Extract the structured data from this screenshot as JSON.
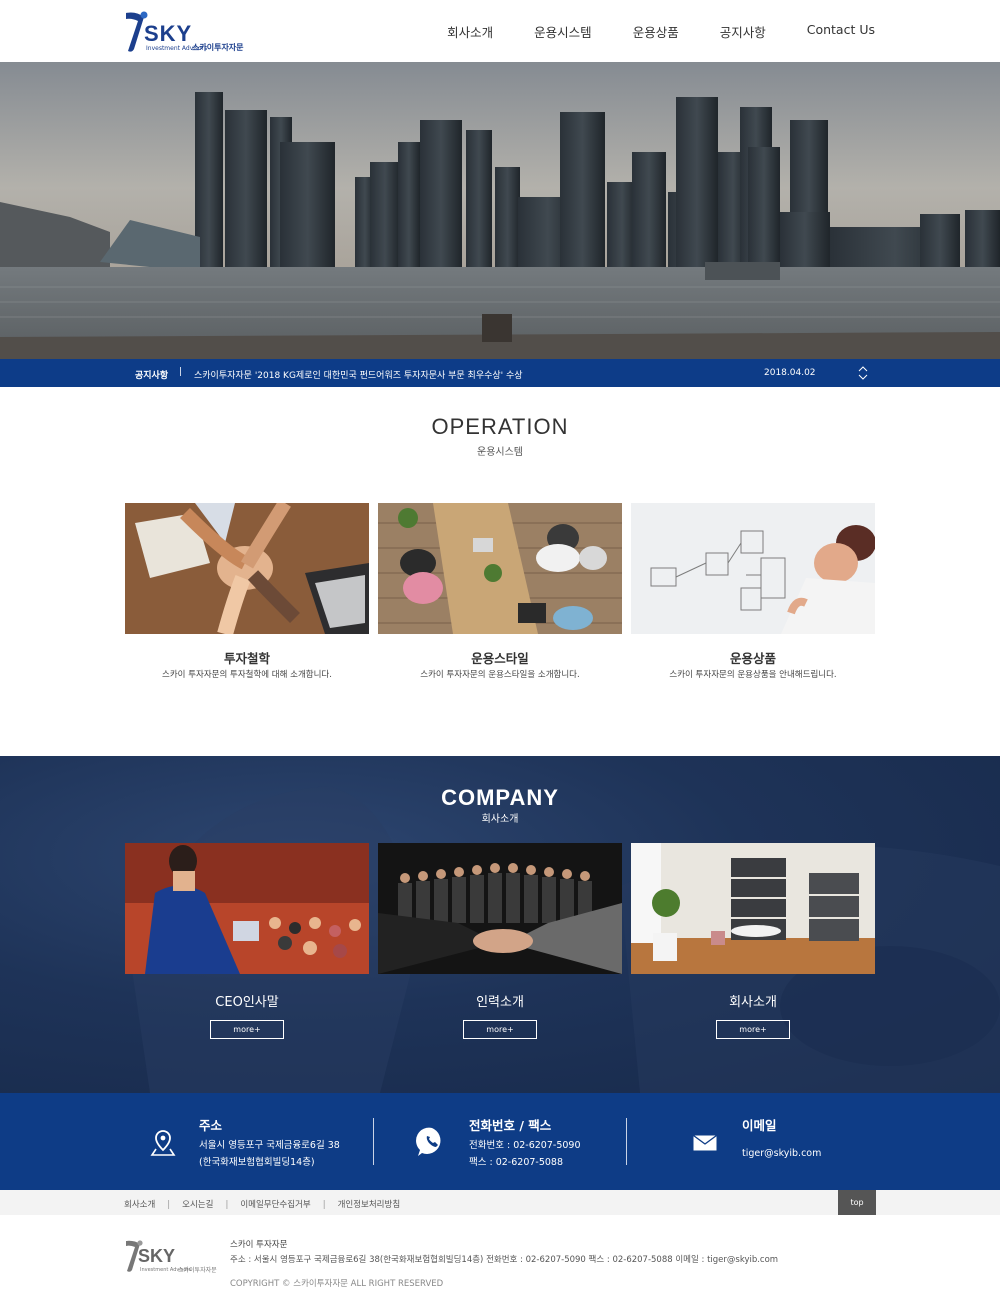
{
  "header": {
    "logo_text": "SKY",
    "logo_sub": "Investment Advisors",
    "logo_kr": "스카이투자자문",
    "nav": [
      "회사소개",
      "운용시스템",
      "운용상품",
      "공지사항",
      "Contact Us"
    ]
  },
  "notice": {
    "label": "공지사항",
    "separator": "|",
    "text": "스카이투자자문 '2018 KG제로인 대한민국 펀드어워즈 투자자문사 부문 최우수상' 수상",
    "date": "2018.04.02"
  },
  "operation": {
    "title": "OPERATION",
    "subtitle": "운용시스템",
    "cards": [
      {
        "title": "투자철학",
        "desc": "스카이 투자자문의 투자철학에 대해 소개합니다."
      },
      {
        "title": "운용스타일",
        "desc": "스카이 투자자문의 운용스타일을 소개합니다."
      },
      {
        "title": "운용상품",
        "desc": "스카이 투자자문의 운용상품을 안내해드립니다."
      }
    ]
  },
  "company": {
    "title": "COMPANY",
    "subtitle": "회사소개",
    "cards": [
      {
        "title": "CEO인사말",
        "more": "more+"
      },
      {
        "title": "인력소개",
        "more": "more+"
      },
      {
        "title": "회사소개",
        "more": "more+"
      }
    ]
  },
  "contact": {
    "address": {
      "title": "주소",
      "line1": "서울시 영등포구 국제금융로6길 38",
      "line2": "(한국화재보험협회빌딩14층)"
    },
    "phone": {
      "title": "전화번호 / 팩스",
      "line1": "전화번호 : 02-6207-5090",
      "line2": "팩스 : 02-6207-5088"
    },
    "email": {
      "title": "이메일",
      "line1": "tiger@skyib.com"
    }
  },
  "footer": {
    "links": [
      "회사소개",
      "오시는길",
      "이메일무단수집거부",
      "개인정보처리방침"
    ],
    "separator": "|",
    "top": "top",
    "logo_text": "SKY",
    "logo_sub": "Investment Advisors",
    "logo_kr": "스카이투자자문",
    "company": "스카이 투자자문",
    "address_line": "주소 : 서울시 영등포구 국제금융로6길 38(한국화재보험협회빌딩14층) 전화번호 : 02-6207-5090 팩스 : 02-6207-5088 이메일 : tiger@skyib.com",
    "copyright": "COPYRIGHT © 스카이투자자문 ALL RIGHT RESERVED"
  },
  "colors": {
    "brand": "#0d3c88",
    "company_bg": "#1e3358",
    "logo": "#1c3f8d"
  },
  "icons": [
    "location-pin-icon",
    "phone-icon",
    "mail-icon",
    "arrow-up-icon",
    "arrow-down-icon"
  ]
}
